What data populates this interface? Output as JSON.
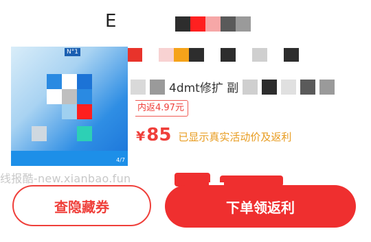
{
  "header": {
    "title_glyph": "E"
  },
  "thumbnail": {
    "book_label": "N°1",
    "corner_tag": "4/7"
  },
  "product": {
    "subtitle_text": "4dmt修扩 副"
  },
  "coupon": {
    "label": "内返4.97元"
  },
  "price": {
    "currency": "¥",
    "value": "85",
    "note": "已显示真实活动价及返利"
  },
  "watermark": {
    "text": "线报酷-new.xianbao.fun"
  },
  "actions": {
    "coupon_button": "查隐藏券",
    "order_button": "下单领返利"
  },
  "colors": {
    "accent": "#ef2f2f",
    "note": "#e89c20"
  }
}
